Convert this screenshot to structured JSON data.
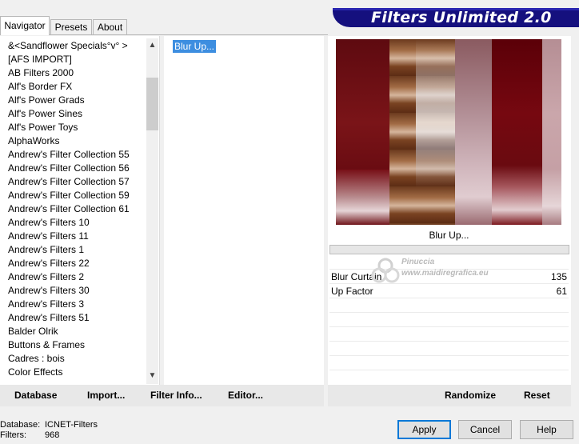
{
  "tabs": [
    "Navigator",
    "Presets",
    "About"
  ],
  "banner_title": "Filters Unlimited 2.0",
  "categories": [
    "&<Sandflower Specials°v° >",
    "[AFS IMPORT]",
    "AB Filters 2000",
    "Alf's Border FX",
    "Alf's Power Grads",
    "Alf's Power Sines",
    "Alf's Power Toys",
    "AlphaWorks",
    "Andrew's Filter Collection 55",
    "Andrew's Filter Collection 56",
    "Andrew's Filter Collection 57",
    "Andrew's Filter Collection 59",
    "Andrew's Filter Collection 61",
    "Andrew's Filters 10",
    "Andrew's Filters 11",
    "Andrew's Filters 1",
    "Andrew's Filters 22",
    "Andrew's Filters 2",
    "Andrew's Filters 30",
    "Andrew's Filters 3",
    "Andrew's Filters 51",
    "Balder Olrik",
    "Buttons & Frames",
    "Cadres : bois",
    "Color Effects"
  ],
  "filter_list": [
    "Blur Up..."
  ],
  "current_filter": "Blur Up...",
  "params": [
    {
      "label": "Blur Curtain",
      "value": "135"
    },
    {
      "label": "Up Factor",
      "value": "61"
    }
  ],
  "toolbar": {
    "database": "Database",
    "import": "Import...",
    "filter_info": "Filter Info...",
    "editor": "Editor...",
    "randomize": "Randomize",
    "reset": "Reset"
  },
  "status": {
    "database_label": "Database:",
    "database_value": "ICNET-Filters",
    "filters_label": "Filters:",
    "filters_value": "968"
  },
  "buttons": {
    "apply": "Apply",
    "cancel": "Cancel",
    "help": "Help"
  },
  "watermark": {
    "name": "Pinuccia",
    "site": "www.maidiregrafica.eu"
  },
  "colors": {
    "banner": "#15107e",
    "selection": "#3d8ee0",
    "preview_red": "#6e0a0f"
  }
}
